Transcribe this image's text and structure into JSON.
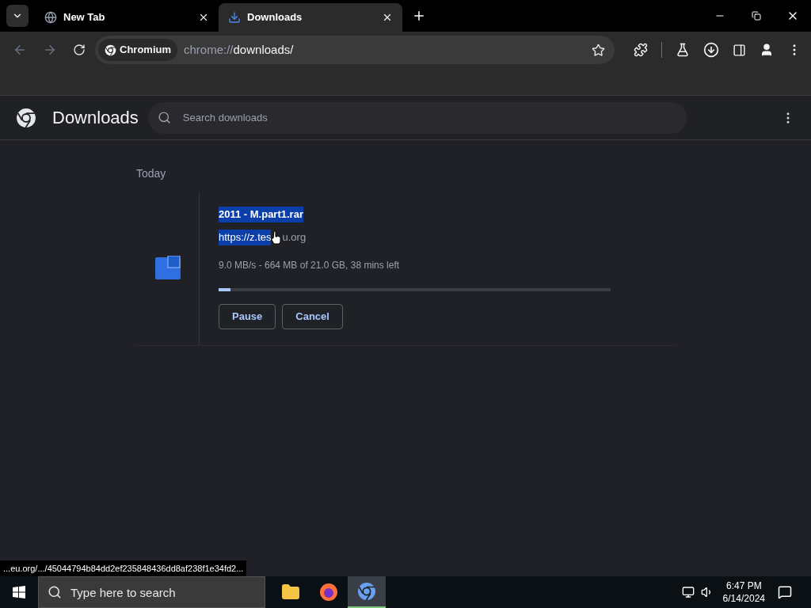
{
  "tabs": [
    {
      "title": "New Tab",
      "kind": "globe",
      "selected": false
    },
    {
      "title": "Downloads",
      "kind": "download",
      "selected": true
    }
  ],
  "toolbar": {
    "site_chip": "Chromium",
    "url_scheme": "chrome://",
    "url_path": "downloads/"
  },
  "page": {
    "title": "Downloads",
    "search": {
      "placeholder": "Search downloads"
    }
  },
  "downloads": {
    "section": "Today",
    "items": [
      {
        "file_name": "2011 - M.part1.rar",
        "file_name_highlighted": true,
        "url_parts": [
          {
            "text": "https://z.tes",
            "highlighted": true
          },
          {
            "text": "u.org",
            "highlighted": false
          }
        ],
        "status": "9.0 MB/s - 664 MB of 21.0 GB, 38 mins left",
        "level": 0.03,
        "buttons": [
          "Pause",
          "Cancel"
        ]
      }
    ]
  },
  "status_bubble": "...eu.org/.../45044794b84dd2ef235848436dd8af238f1e34fd2...",
  "taskbar": {
    "search": {
      "placeholder": "Type here to search"
    },
    "apps": [
      {
        "kind": "folder",
        "selected": false
      },
      {
        "kind": "firefox",
        "selected": false
      },
      {
        "kind": "chromium",
        "selected": true
      }
    ],
    "time": "6:47 PM",
    "date": "6/14/2024"
  }
}
